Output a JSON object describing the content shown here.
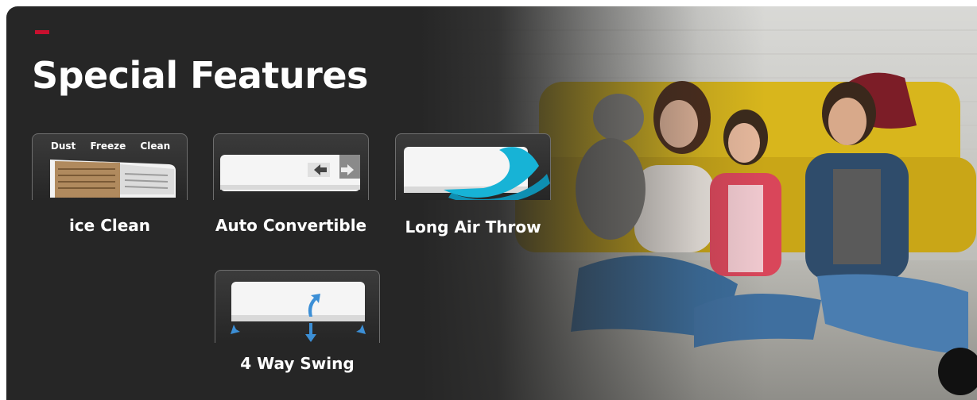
{
  "banner": {
    "title": "Special Features",
    "accent_color": "#c8102e",
    "background_color": "#262626"
  },
  "features": [
    {
      "label": "ice Clean",
      "icon": "ice-clean-icon",
      "tags": [
        "Dust",
        "Freeze",
        "Clean"
      ]
    },
    {
      "label": "Auto Convertible",
      "icon": "auto-convertible-icon"
    },
    {
      "label": "Long Air Throw",
      "icon": "long-air-throw-icon"
    },
    {
      "label": "4 Way Swing",
      "icon": "four-way-swing-icon"
    }
  ],
  "photo": {
    "subject": "family-sitting-on-floor"
  }
}
